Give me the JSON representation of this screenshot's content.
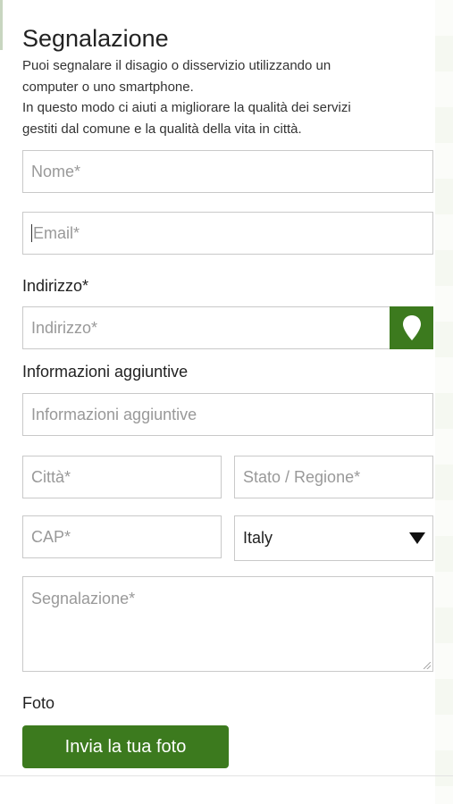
{
  "form": {
    "title": "Segnalazione",
    "intro_line1": "Puoi segnalare il disagio o disservizio utilizzando un",
    "intro_line2": "computer o uno smartphone.",
    "intro_line3": "In questo modo ci aiuti a migliorare la qualità dei servizi",
    "intro_line4": "gestiti dal comune e la qualità della vita in città.",
    "nome_placeholder": "Nome*",
    "email_placeholder": "Email*",
    "indirizzo_label": "Indirizzo*",
    "indirizzo_placeholder": "Indirizzo*",
    "info_label": "Informazioni aggiuntive",
    "info_placeholder": "Informazioni aggiuntive",
    "citta_placeholder": "Città*",
    "stato_placeholder": "Stato / Regione*",
    "cap_placeholder": "CAP*",
    "country_value": "Italy",
    "segnalazione_placeholder": "Segnalazione*",
    "foto_label": "Foto",
    "photo_button": "Invia la tua foto"
  },
  "icons": {
    "location": "map-pin-icon",
    "dropdown": "triangle-down-icon"
  },
  "colors": {
    "accent": "#3c7a1e",
    "border": "#c9c9c9",
    "placeholder": "#999999"
  }
}
